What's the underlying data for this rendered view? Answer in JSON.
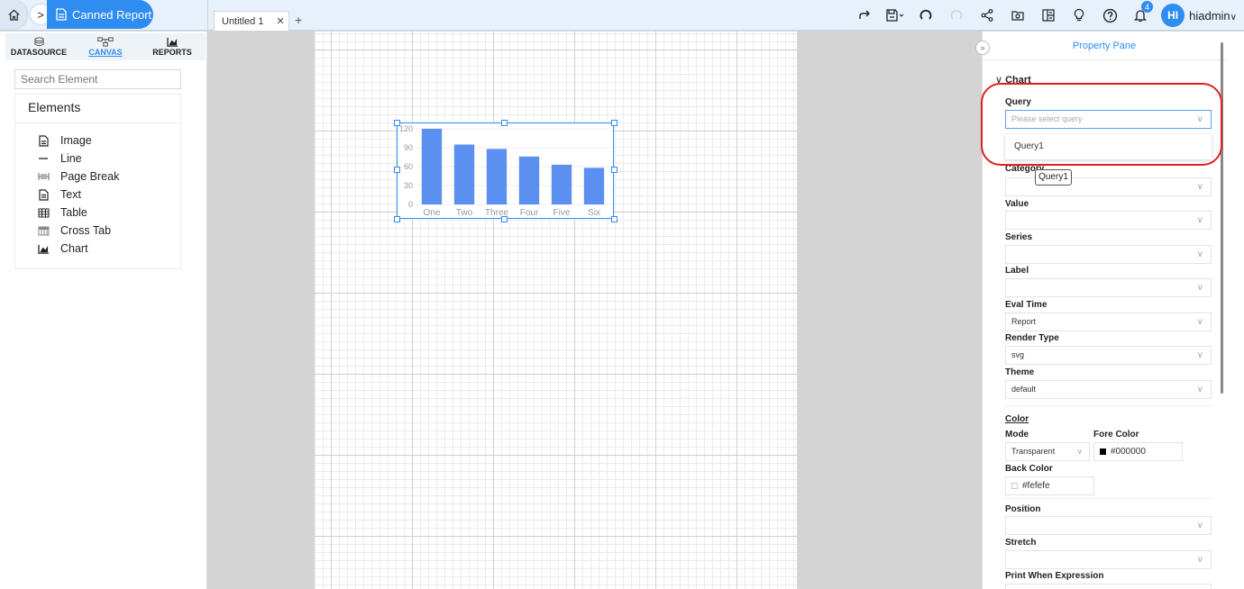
{
  "topbar": {
    "report_label": "Canned Report",
    "crumb_arrow": ">",
    "tab_label": "Untitled 1",
    "tab_close": "✕",
    "add_tab": "+",
    "notification_count": "4",
    "avatar_initials": "HI",
    "username": "hiadmin",
    "icons": [
      "redo-icon",
      "save-icon",
      "refresh-icon",
      "refresh-disabled-icon",
      "share-icon",
      "export-icon",
      "layout-icon",
      "lightbulb-icon",
      "help-icon",
      "bell-icon"
    ]
  },
  "left_panel": {
    "tabs": [
      {
        "label": "DATASOURCE",
        "icon": "database-icon",
        "active": false
      },
      {
        "label": "CANVAS",
        "icon": "canvas-icon",
        "active": true
      },
      {
        "label": "REPORTS",
        "icon": "chart-icon",
        "active": false
      }
    ],
    "search_placeholder": "Search Element",
    "elements_title": "Elements",
    "elements": [
      {
        "label": "Image",
        "icon": "image-file-icon"
      },
      {
        "label": "Line",
        "icon": "line-icon"
      },
      {
        "label": "Page Break",
        "icon": "page-break-icon"
      },
      {
        "label": "Text",
        "icon": "text-file-icon"
      },
      {
        "label": "Table",
        "icon": "table-icon"
      },
      {
        "label": "Cross Tab",
        "icon": "crosstab-icon"
      },
      {
        "label": "Chart",
        "icon": "chart-icon"
      }
    ]
  },
  "chart_data": {
    "type": "bar",
    "categories": [
      "One",
      "Two",
      "Three",
      "Four",
      "Five",
      "Six"
    ],
    "values": [
      120,
      95,
      88,
      76,
      63,
      58
    ],
    "yticks": [
      "120",
      "90",
      "60",
      "30",
      "0"
    ],
    "ylim": [
      0,
      120
    ],
    "bar_color": "#5b8ff0",
    "grid": true
  },
  "property_pane": {
    "title": "Property Pane",
    "collapse_label": "»",
    "section": "Chart",
    "query_label": "Query",
    "query_placeholder": "Please select query",
    "query_option": "Query1",
    "tooltip_text": "Query1",
    "category_label": "Category",
    "value_label": "Value",
    "series_label": "Series",
    "label_label": "Label",
    "eval_time_label": "Eval Time",
    "eval_time_value": "Report",
    "render_type_label": "Render Type",
    "render_type_value": "svg",
    "theme_label": "Theme",
    "theme_value": "default",
    "color_label": "Color",
    "mode_label": "Mode",
    "mode_value": "Transparent",
    "fore_color_label": "Fore Color",
    "fore_color_value": "#000000",
    "back_color_label": "Back Color",
    "back_color_value": "#fefefe",
    "position_label": "Position",
    "stretch_label": "Stretch",
    "print_when_label": "Print When Expression"
  },
  "colors": {
    "accent": "#2f8cf0",
    "highlight_ring": "#e02020"
  }
}
